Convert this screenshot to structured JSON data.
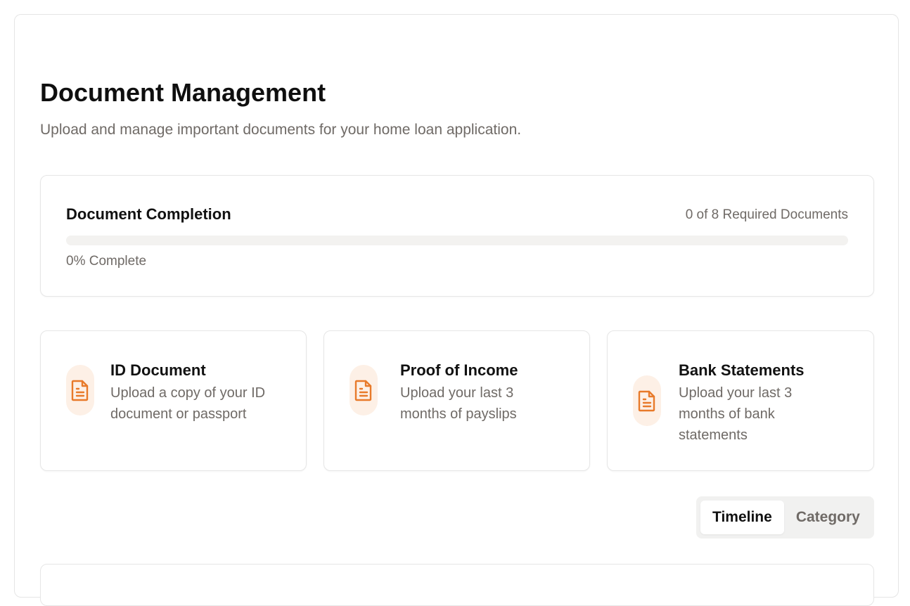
{
  "header": {
    "title": "Document Management",
    "subtitle": "Upload and manage important documents for your home loan application."
  },
  "completion": {
    "title": "Document Completion",
    "count_text": "0 of 8 Required Documents",
    "percent_text": "0% Complete",
    "progress_fraction": 0,
    "accent_color": "#e87a2a"
  },
  "document_cards": [
    {
      "icon": "file-text-icon",
      "title": "ID Document",
      "description": "Upload a copy of your ID document or passport"
    },
    {
      "icon": "file-text-icon",
      "title": "Proof of Income",
      "description": "Upload your last 3 months of payslips"
    },
    {
      "icon": "file-text-icon",
      "title": "Bank Statements",
      "description": "Upload your last 3 months of bank statements"
    }
  ],
  "view_toggle": {
    "options": [
      "Timeline",
      "Category"
    ],
    "selected": "Timeline"
  },
  "colors": {
    "accent": "#e87a2a",
    "icon_bg": "#fdf0e6",
    "muted_text": "#6f6a66"
  }
}
